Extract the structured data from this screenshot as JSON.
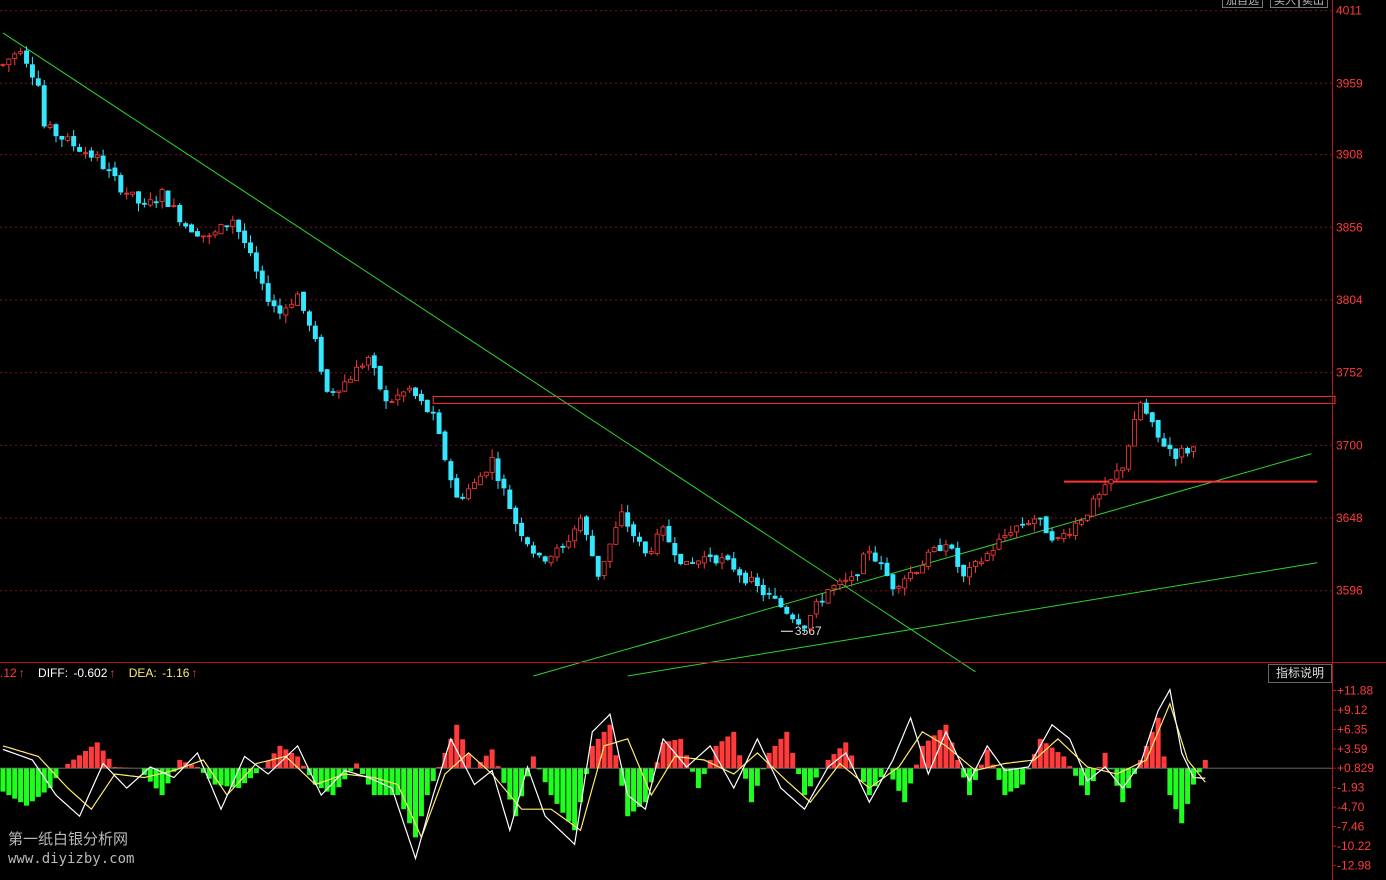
{
  "toolbar": {
    "buttons": [
      "加自选",
      "买入",
      "卖出"
    ]
  },
  "macd_readout": {
    "macd_value": ".12",
    "diff_label": "DIFF:",
    "diff_value": "-0.602",
    "dea_label": "DEA:",
    "dea_value": "-1.16",
    "arrow": "↑"
  },
  "indicator_button": "指标说明",
  "watermark": {
    "line1": "第一纸白银分析网",
    "line2": "www.diyizby.com"
  },
  "colors": {
    "background": "#000000",
    "up": "#ff3b3b",
    "down": "#35e6ff",
    "grid": "#7a1515",
    "trendline": "#2ed52e",
    "resistance": "#ff3333",
    "macd_positive": "#ff3b3b",
    "macd_negative": "#1fff1f",
    "diff_line": "#ffffff",
    "dea_line": "#ffeb6b",
    "axis_text": "#ff3b3b"
  },
  "chart_data": [
    {
      "type": "candlestick",
      "title": "",
      "y_axis_ticks": [
        "4011",
        "3959",
        "3908",
        "3856",
        "3804",
        "3752",
        "3700",
        "3648",
        "3596"
      ],
      "ylim": [
        3545,
        4015
      ],
      "grid": true,
      "low_annotation": {
        "label": "3567",
        "value": 3567
      },
      "price_path": [
        [
          0,
          3972
        ],
        [
          3,
          3985
        ],
        [
          6,
          3958
        ],
        [
          7,
          3928
        ],
        [
          12,
          3915
        ],
        [
          16,
          3905
        ],
        [
          20,
          3885
        ],
        [
          24,
          3870
        ],
        [
          27,
          3880
        ],
        [
          31,
          3858
        ],
        [
          35,
          3848
        ],
        [
          39,
          3862
        ],
        [
          41,
          3845
        ],
        [
          44,
          3812
        ],
        [
          47,
          3795
        ],
        [
          50,
          3808
        ],
        [
          53,
          3773
        ],
        [
          55,
          3738
        ],
        [
          58,
          3745
        ],
        [
          62,
          3763
        ],
        [
          65,
          3730
        ],
        [
          69,
          3740
        ],
        [
          73,
          3720
        ],
        [
          77,
          3662
        ],
        [
          80,
          3672
        ],
        [
          83,
          3690
        ],
        [
          87,
          3645
        ],
        [
          91,
          3618
        ],
        [
          95,
          3626
        ],
        [
          98,
          3648
        ],
        [
          101,
          3608
        ],
        [
          105,
          3650
        ],
        [
          109,
          3622
        ],
        [
          112,
          3638
        ],
        [
          116,
          3613
        ],
        [
          120,
          3622
        ],
        [
          124,
          3613
        ],
        [
          128,
          3598
        ],
        [
          132,
          3585
        ],
        [
          136,
          3572
        ],
        [
          140,
          3597
        ],
        [
          144,
          3603
        ],
        [
          147,
          3626
        ],
        [
          151,
          3600
        ],
        [
          155,
          3612
        ],
        [
          160,
          3632
        ],
        [
          163,
          3605
        ],
        [
          167,
          3622
        ],
        [
          171,
          3640
        ],
        [
          175,
          3648
        ],
        [
          179,
          3632
        ],
        [
          183,
          3648
        ],
        [
          187,
          3668
        ],
        [
          190,
          3686
        ],
        [
          193,
          3730
        ],
        [
          196,
          3705
        ],
        [
          199,
          3694
        ],
        [
          202,
          3698
        ]
      ],
      "trendlines": [
        {
          "name": "descending-resistance",
          "from": [
            0,
            3995
          ],
          "to": [
            165,
            3538
          ]
        },
        {
          "name": "rising-support-upper",
          "from": [
            90,
            3535
          ],
          "to": [
            222,
            3694
          ]
        },
        {
          "name": "rising-support-lower",
          "from": [
            106,
            3535
          ],
          "to": [
            223,
            3616
          ]
        }
      ],
      "levels": [
        {
          "name": "resistance-zone",
          "from_x": 73,
          "to_x": 226,
          "value_high": 3735,
          "value_low": 3730
        },
        {
          "name": "breakout-line",
          "from_x": 180,
          "to_x": 223,
          "value": 3674
        }
      ],
      "bars_in_view": 226
    },
    {
      "type": "bar",
      "subtype": "macd",
      "title": "",
      "y_axis_ticks": [
        "+11.88",
        "+9.12",
        "+6.35",
        "+3.59",
        "+0.829",
        "-1.93",
        "-4.70",
        "-7.46",
        "-10.22",
        "-12.98"
      ],
      "ylim": [
        -14.5,
        12.8
      ],
      "zero": 0.829,
      "histogram": [
        [
          0,
          -2.5
        ],
        [
          4,
          -4.5
        ],
        [
          8,
          -2
        ],
        [
          10,
          0.829
        ],
        [
          16,
          4.5
        ],
        [
          19,
          1
        ],
        [
          23,
          0.829
        ],
        [
          27,
          -3
        ],
        [
          30,
          2
        ],
        [
          33,
          1
        ],
        [
          36,
          -1.5
        ],
        [
          40,
          -2
        ],
        [
          44,
          0.829
        ],
        [
          47,
          4
        ],
        [
          50,
          2.5
        ],
        [
          53,
          -1.5
        ],
        [
          56,
          -3
        ],
        [
          60,
          1.5
        ],
        [
          63,
          -3
        ],
        [
          67,
          -3
        ],
        [
          70,
          -9
        ],
        [
          72,
          -3
        ],
        [
          75,
          3
        ],
        [
          77,
          7
        ],
        [
          80,
          0.829
        ],
        [
          83,
          3.5
        ],
        [
          87,
          -6
        ],
        [
          90,
          2.5
        ],
        [
          93,
          -3
        ],
        [
          97,
          -8
        ],
        [
          100,
          4
        ],
        [
          103,
          7
        ],
        [
          106,
          -6
        ],
        [
          109,
          -4
        ],
        [
          112,
          4.5
        ],
        [
          115,
          5
        ],
        [
          118,
          -2
        ],
        [
          121,
          4
        ],
        [
          124,
          6
        ],
        [
          127,
          -4
        ],
        [
          130,
          3
        ],
        [
          133,
          6
        ],
        [
          136,
          -3
        ],
        [
          140,
          2
        ],
        [
          143,
          4.5
        ],
        [
          147,
          -3
        ],
        [
          150,
          0.829
        ],
        [
          153,
          -4
        ],
        [
          156,
          4
        ],
        [
          160,
          7
        ],
        [
          164,
          -3
        ],
        [
          167,
          3.5
        ],
        [
          170,
          -3
        ],
        [
          173,
          -1.5
        ],
        [
          176,
          5
        ],
        [
          180,
          2.5
        ],
        [
          184,
          -3
        ],
        [
          187,
          3
        ],
        [
          190,
          -4
        ],
        [
          193,
          2
        ],
        [
          196,
          8
        ],
        [
          198,
          -3
        ],
        [
          200,
          -7
        ],
        [
          202,
          -1.5
        ],
        [
          204,
          2
        ]
      ],
      "diff": [
        [
          0,
          3.5
        ],
        [
          5,
          2
        ],
        [
          9,
          -3
        ],
        [
          13,
          -6
        ],
        [
          17,
          1.5
        ],
        [
          21,
          -2
        ],
        [
          25,
          1
        ],
        [
          29,
          -0.5
        ],
        [
          33,
          3
        ],
        [
          37,
          -5
        ],
        [
          41,
          2.5
        ],
        [
          45,
          0
        ],
        [
          50,
          4
        ],
        [
          54,
          -3
        ],
        [
          58,
          0.5
        ],
        [
          62,
          -0.5
        ],
        [
          66,
          -2
        ],
        [
          70,
          -12
        ],
        [
          73,
          -3
        ],
        [
          76,
          5
        ],
        [
          80,
          -1.5
        ],
        [
          83,
          0.5
        ],
        [
          86,
          -8
        ],
        [
          89,
          1
        ],
        [
          92,
          -6
        ],
        [
          97,
          -10
        ],
        [
          100,
          6
        ],
        [
          103,
          8.5
        ],
        [
          106,
          -3
        ],
        [
          109,
          -5
        ],
        [
          112,
          5
        ],
        [
          116,
          1
        ],
        [
          120,
          4
        ],
        [
          124,
          -2
        ],
        [
          128,
          5
        ],
        [
          132,
          -2
        ],
        [
          136,
          -5
        ],
        [
          140,
          1
        ],
        [
          143,
          3
        ],
        [
          147,
          -4
        ],
        [
          151,
          2
        ],
        [
          154,
          8
        ],
        [
          157,
          0
        ],
        [
          160,
          6
        ],
        [
          164,
          -1
        ],
        [
          167,
          4
        ],
        [
          170,
          0.5
        ],
        [
          174,
          1
        ],
        [
          178,
          7
        ],
        [
          181,
          5
        ],
        [
          184,
          -1
        ],
        [
          187,
          1
        ],
        [
          190,
          -2
        ],
        [
          193,
          1.5
        ],
        [
          196,
          9
        ],
        [
          198,
          12
        ],
        [
          200,
          3
        ],
        [
          202,
          -0.5
        ],
        [
          204,
          -0.6
        ]
      ],
      "dea": [
        [
          0,
          4
        ],
        [
          6,
          2.5
        ],
        [
          11,
          -2
        ],
        [
          15,
          -5
        ],
        [
          19,
          0
        ],
        [
          24,
          -0.5
        ],
        [
          29,
          0.5
        ],
        [
          34,
          2
        ],
        [
          38,
          -3
        ],
        [
          43,
          1.5
        ],
        [
          48,
          2.5
        ],
        [
          53,
          -1.5
        ],
        [
          58,
          0
        ],
        [
          63,
          -0.5
        ],
        [
          67,
          -1.5
        ],
        [
          71,
          -9
        ],
        [
          75,
          0
        ],
        [
          79,
          3
        ],
        [
          83,
          0
        ],
        [
          88,
          -5
        ],
        [
          93,
          -5
        ],
        [
          98,
          -8
        ],
        [
          102,
          4
        ],
        [
          106,
          5
        ],
        [
          110,
          -3
        ],
        [
          114,
          2.5
        ],
        [
          119,
          2
        ],
        [
          124,
          0
        ],
        [
          128,
          3
        ],
        [
          133,
          -1
        ],
        [
          137,
          -4
        ],
        [
          142,
          1.5
        ],
        [
          147,
          -2
        ],
        [
          152,
          1
        ],
        [
          156,
          6
        ],
        [
          160,
          4
        ],
        [
          165,
          0.5
        ],
        [
          170,
          1.5
        ],
        [
          175,
          2
        ],
        [
          179,
          5
        ],
        [
          184,
          1
        ],
        [
          189,
          0
        ],
        [
          194,
          2
        ],
        [
          198,
          10
        ],
        [
          201,
          2
        ],
        [
          204,
          -1.16
        ]
      ]
    }
  ]
}
